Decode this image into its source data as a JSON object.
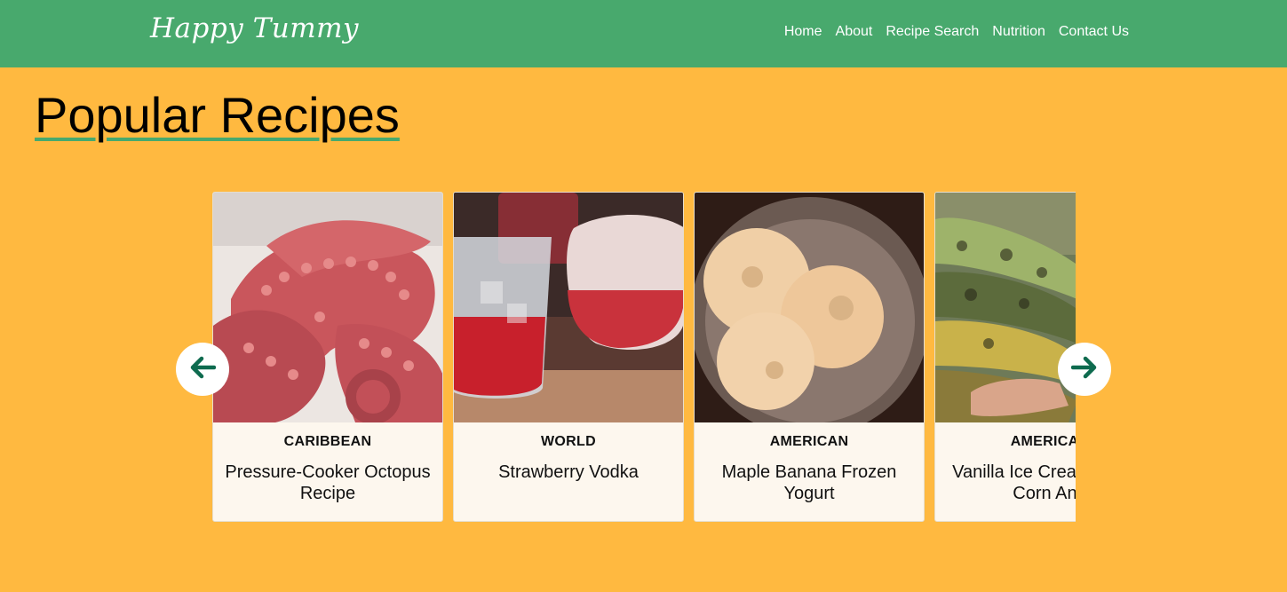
{
  "nav": {
    "logo": "Happy Tummy",
    "links": [
      "Home",
      "About",
      "Recipe Search",
      "Nutrition",
      "Contact Us"
    ]
  },
  "page": {
    "title": "Popular Recipes"
  },
  "carousel": {
    "prev_icon": "arrow-left-icon",
    "next_icon": "arrow-right-icon",
    "cards": [
      {
        "cuisine": "CARIBBEAN",
        "title": "Pressure-Cooker Octopus Recipe"
      },
      {
        "cuisine": "WORLD",
        "title": "Strawberry Vodka"
      },
      {
        "cuisine": "AMERICAN",
        "title": "Maple Banana Frozen Yogurt"
      },
      {
        "cuisine": "AMERICAN",
        "title": "Vanilla Ice Cream Grilled Corn And"
      }
    ]
  },
  "colors": {
    "navbar": "#48a96d",
    "background": "#ffb940",
    "card": "#fdf7ee",
    "arrow": "#0e6b4f",
    "underline": "#48a96d"
  }
}
